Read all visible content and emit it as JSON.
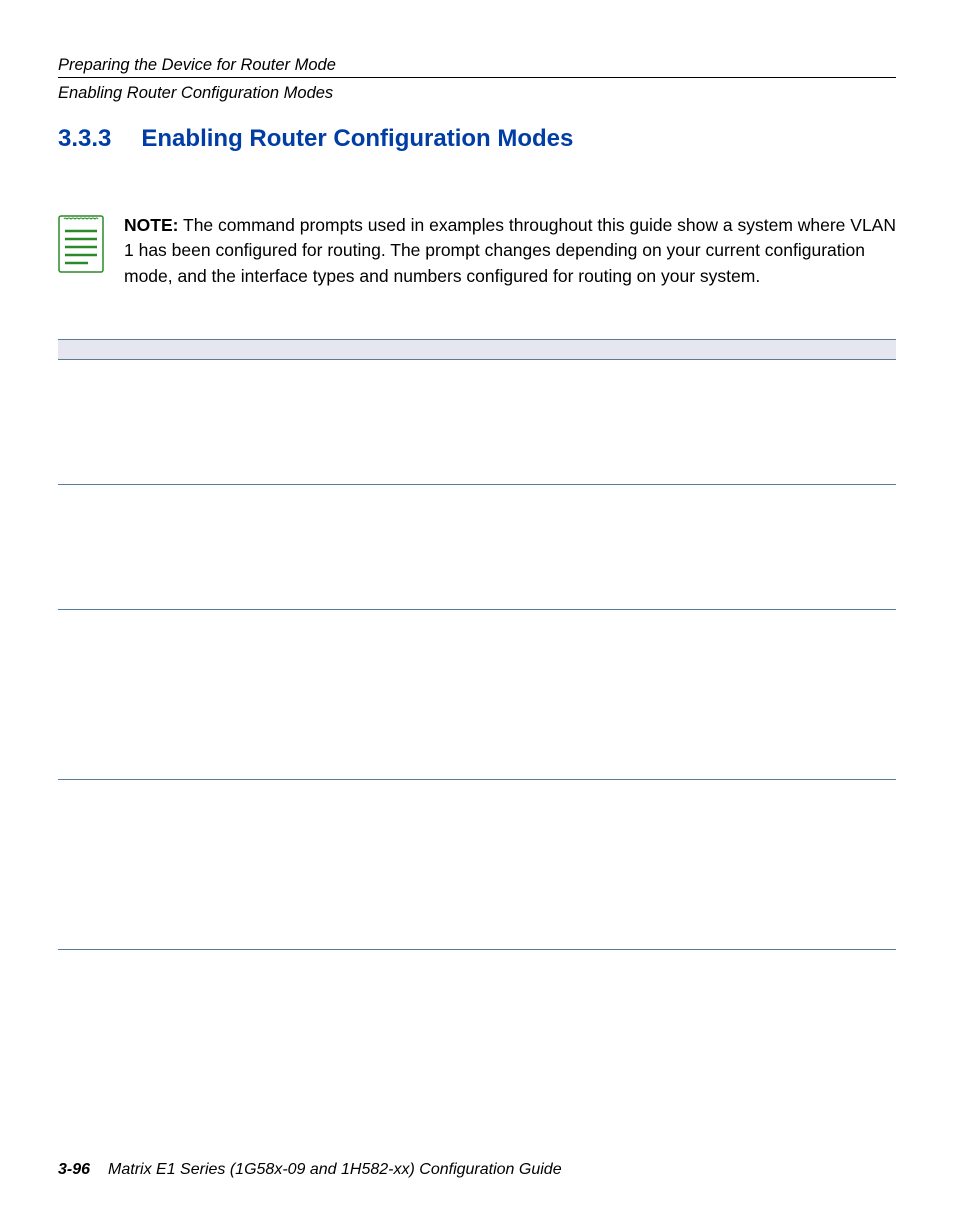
{
  "header": {
    "chapter": "Preparing the Device for Router Mode",
    "section": "Enabling Router Configuration Modes"
  },
  "heading": {
    "number": "3.3.3",
    "title": "Enabling Router Configuration Modes"
  },
  "note": {
    "label": "NOTE:",
    "text": "The command prompts used in examples throughout this guide show a system where VLAN 1 has been configured for routing. The prompt changes depending on your current configuration mode, and the interface types and numbers configured for routing on your system."
  },
  "footer": {
    "page": "3-96",
    "title": "Matrix E1 Series (1G58x-09 and 1H582-xx) Configuration Guide"
  }
}
